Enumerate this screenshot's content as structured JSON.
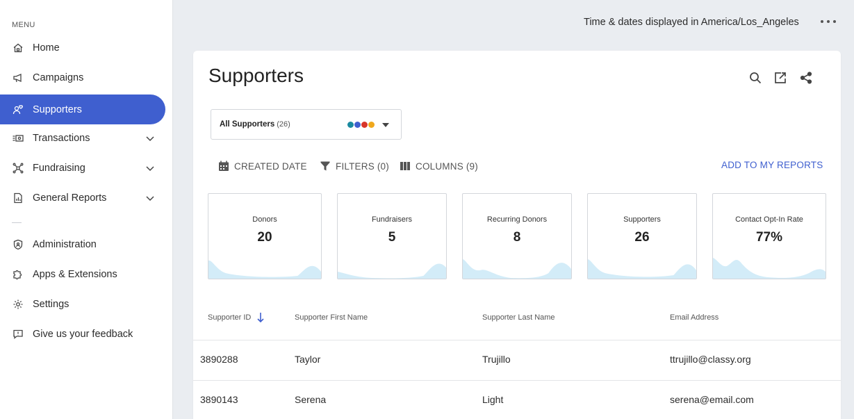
{
  "sidebar": {
    "menu_label": "MENU",
    "items": [
      {
        "label": "Home",
        "icon": "home-icon"
      },
      {
        "label": "Campaigns",
        "icon": "megaphone-icon"
      },
      {
        "label": "Supporters",
        "icon": "supporters-icon",
        "active": true
      },
      {
        "label": "Transactions",
        "icon": "transactions-icon",
        "expandable": true
      },
      {
        "label": "Fundraising",
        "icon": "fundraising-icon",
        "expandable": true
      },
      {
        "label": "General Reports",
        "icon": "reports-icon",
        "expandable": true
      },
      {
        "label": "Administration",
        "icon": "shield-icon"
      },
      {
        "label": "Apps & Extensions",
        "icon": "puzzle-icon"
      },
      {
        "label": "Settings",
        "icon": "gear-icon"
      },
      {
        "label": "Give us your feedback",
        "icon": "feedback-icon"
      }
    ]
  },
  "topbar": {
    "timezone_text": "Time & dates displayed in America/Los_Angeles",
    "more_icon": "more-horizontal-icon"
  },
  "page": {
    "title": "Supporters",
    "toolbar_icons": [
      "search-icon",
      "export-icon",
      "share-icon"
    ]
  },
  "selector": {
    "label": "All Supporters",
    "count": "(26)",
    "dot_colors": [
      "#1a8aa0",
      "#3f5fcf",
      "#d8352a",
      "#f0a81c"
    ]
  },
  "filters": {
    "created_date": "CREATED DATE",
    "filters": "FILTERS (0)",
    "columns": "COLUMNS (9)",
    "add_reports": "ADD TO MY REPORTS"
  },
  "stats": [
    {
      "label": "Donors",
      "value": "20"
    },
    {
      "label": "Fundraisers",
      "value": "5"
    },
    {
      "label": "Recurring Donors",
      "value": "8"
    },
    {
      "label": "Supporters",
      "value": "26"
    },
    {
      "label": "Contact Opt-In Rate",
      "value": "77%"
    }
  ],
  "table": {
    "headers": [
      "Supporter ID",
      "Supporter First Name",
      "Supporter Last Name",
      "Email Address"
    ],
    "rows": [
      [
        "3890288",
        "Taylor",
        "Trujillo",
        "ttrujillo@classy.org"
      ],
      [
        "3890143",
        "Serena",
        "Light",
        "serena@email.com"
      ]
    ]
  },
  "colors": {
    "accent": "#3f5fcf",
    "sparkline_fill": "#d3ecf8"
  }
}
